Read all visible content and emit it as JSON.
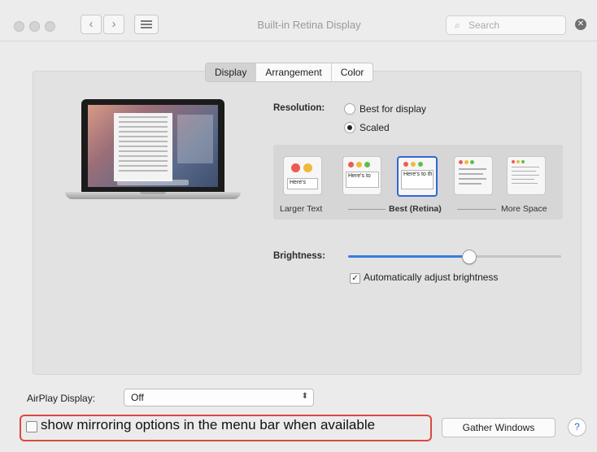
{
  "window": {
    "title": "Built-in Retina Display",
    "search_placeholder": "Search",
    "back_glyph": "‹",
    "forward_glyph": "›",
    "clear_glyph": "✕"
  },
  "tabs": [
    {
      "label": "Display",
      "selected": true
    },
    {
      "label": "Arrangement",
      "selected": false
    },
    {
      "label": "Color",
      "selected": false
    }
  ],
  "resolution": {
    "label": "Resolution:",
    "options": [
      {
        "label": "Best for display",
        "selected": false
      },
      {
        "label": "Scaled",
        "selected": true
      }
    ]
  },
  "scaled_options": {
    "left_label": "Larger Text",
    "center_label": "Best (Retina)",
    "right_label": "More Space",
    "preview_text_1": "Here's",
    "preview_text_2": "Here's to",
    "preview_text_3": "Here's to th",
    "selected_index": 2
  },
  "brightness": {
    "label": "Brightness:",
    "level_percent": 57,
    "auto_label": "Automatically adjust brightness",
    "auto_checked": true
  },
  "airplay": {
    "label": "AirPlay Display:",
    "value": "Off"
  },
  "mirroring": {
    "label": "show mirroring options in the menu bar when available",
    "checked": false
  },
  "buttons": {
    "gather": "Gather Windows",
    "help": "?"
  },
  "colors": {
    "accent": "#2f68d4",
    "highlight_border": "#d94a3c",
    "red": "#ec5b53",
    "yellow": "#f1b93a",
    "green": "#5cc04a"
  },
  "icons": [
    "back-icon",
    "forward-icon",
    "grid-icon",
    "search-icon",
    "clear-icon",
    "help-icon"
  ]
}
